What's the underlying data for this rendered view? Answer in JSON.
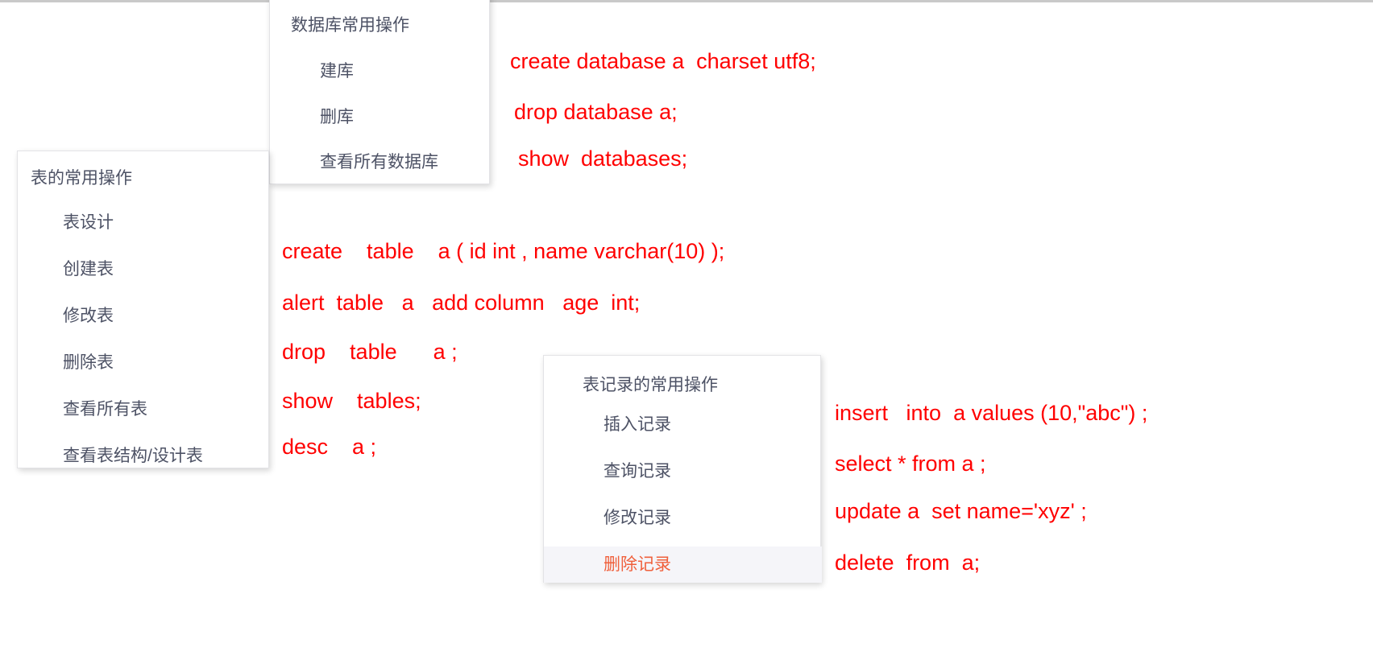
{
  "colors": {
    "sql_red": "#ff0000",
    "panel_text": "#4d5265",
    "highlight_text": "#f0603c",
    "highlight_bg": "#f5f5f9",
    "panel_bg": "#ffffff",
    "page_bg": "#ffffff",
    "rule": "#c9c9c9"
  },
  "database_panel": {
    "title": "数据库常用操作",
    "items": [
      {
        "label": "建库"
      },
      {
        "label": "删库"
      },
      {
        "label": "查看所有数据库"
      }
    ]
  },
  "database_sql": [
    "create database a  charset utf8;",
    "drop database a;",
    "show  databases;"
  ],
  "table_panel": {
    "title": "表的常用操作",
    "items": [
      {
        "label": "表设计"
      },
      {
        "label": "创建表"
      },
      {
        "label": "修改表"
      },
      {
        "label": "删除表"
      },
      {
        "label": "查看所有表"
      },
      {
        "label": "查看表结构/设计表"
      }
    ]
  },
  "table_sql": [
    "create    table    a ( id int , name varchar(10) );",
    "alert  table   a   add column   age  int;",
    "drop    table      a ;",
    "show    tables;",
    "desc    a ;"
  ],
  "record_panel": {
    "title": "表记录的常用操作",
    "items": [
      {
        "label": "插入记录",
        "highlighted": false
      },
      {
        "label": "查询记录",
        "highlighted": false
      },
      {
        "label": "修改记录",
        "highlighted": false
      },
      {
        "label": "删除记录",
        "highlighted": true
      }
    ]
  },
  "record_sql": [
    "insert   into  a values (10,\"abc\") ;",
    "select * from a ;",
    "update a  set name='xyz' ;",
    "delete  from  a;"
  ]
}
